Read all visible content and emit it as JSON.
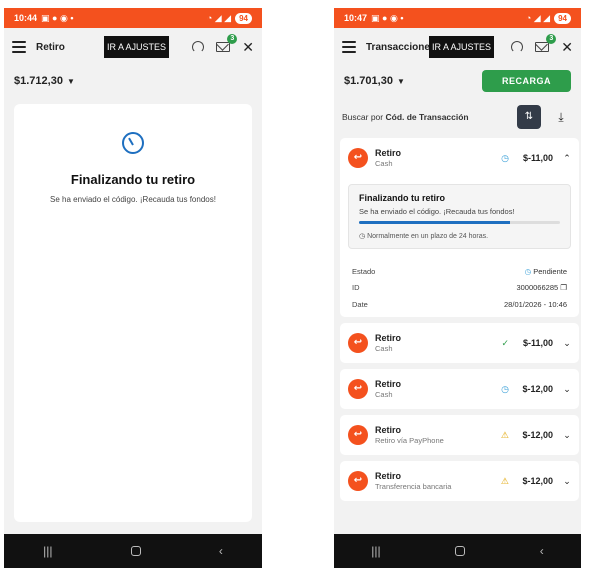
{
  "left": {
    "status": {
      "time": "10:44",
      "battery": "94"
    },
    "header": {
      "title": "Retiro",
      "ajustes": "IR A AJUSTES",
      "mail_badge": "3"
    },
    "balance": "$1.712,30",
    "card": {
      "title": "Finalizando tu retiro",
      "message": "Se ha enviado el código. ¡Recauda tus fondos!"
    }
  },
  "right": {
    "status": {
      "time": "10:47",
      "battery": "94"
    },
    "header": {
      "title": "Transacciones",
      "ajustes": "IR A AJUSTES",
      "mail_badge": "3"
    },
    "balance": "$1.701,30",
    "recarga": "RECARGA",
    "search": {
      "prefix": "Buscar por",
      "field": "Cód. de Transacción"
    },
    "expanded": {
      "name": "Retiro",
      "sub": "Cash",
      "amount": "$-11,00",
      "detail_title": "Finalizando tu retiro",
      "detail_msg": "Se ha enviado el código. ¡Recauda tus fondos!",
      "progress": 0.75,
      "note": "Normalmente en un plazo de 24 horas.",
      "estado_label": "Estado",
      "estado_value": "Pendiente",
      "id_label": "ID",
      "id_value": "3000066285",
      "date_label": "Date",
      "date_value": "28/01/2026 - 10:46"
    },
    "transactions": [
      {
        "name": "Retiro",
        "sub": "Cash",
        "amount": "$-11,00",
        "status": "completed"
      },
      {
        "name": "Retiro",
        "sub": "Cash",
        "amount": "$-12,00",
        "status": "pending"
      },
      {
        "name": "Retiro",
        "sub": "Retiro vía PayPhone",
        "amount": "$-12,00",
        "status": "warning"
      },
      {
        "name": "Retiro",
        "sub": "Transferencia bancaria",
        "amount": "$-12,00",
        "status": "warning"
      }
    ]
  }
}
